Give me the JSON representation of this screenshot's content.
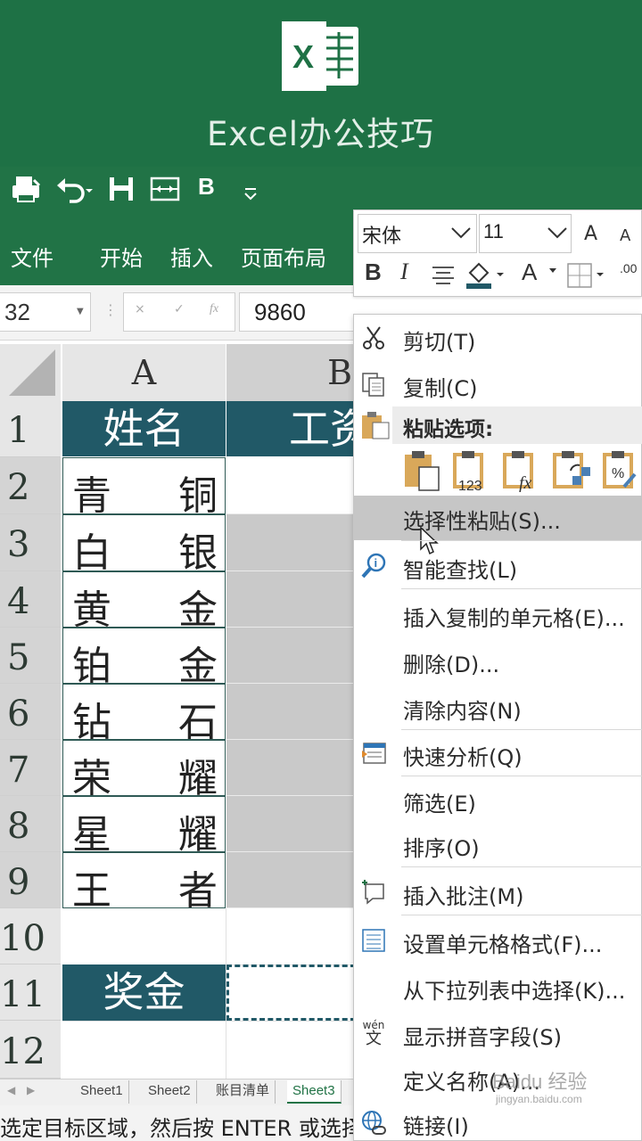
{
  "brand": {
    "logo_letter": "X",
    "title": "Excel办公技巧"
  },
  "qat": {
    "bold_label": "B"
  },
  "ribbon_tabs": [
    "文件",
    "开始",
    "插入",
    "页面布局"
  ],
  "formula_bar": {
    "name_box": "32",
    "value": "9860",
    "fx": "fx",
    "cancel": "×",
    "enter": "✓"
  },
  "columns": [
    "A",
    "B"
  ],
  "rows": [
    {
      "num": "1",
      "a": "姓名",
      "b": "工资",
      "header": true
    },
    {
      "num": "2",
      "a_left": "青",
      "a_right": "铜"
    },
    {
      "num": "3",
      "a_left": "白",
      "a_right": "银"
    },
    {
      "num": "4",
      "a_left": "黄",
      "a_right": "金"
    },
    {
      "num": "5",
      "a_left": "铂",
      "a_right": "金"
    },
    {
      "num": "6",
      "a_left": "钻",
      "a_right": "石"
    },
    {
      "num": "7",
      "a_left": "荣",
      "a_right": "耀"
    },
    {
      "num": "8",
      "a_left": "星",
      "a_right": "耀"
    },
    {
      "num": "9",
      "a_left": "王",
      "a_right": "者"
    },
    {
      "num": "10"
    },
    {
      "num": "11",
      "a": "奖金",
      "header": true
    },
    {
      "num": "12"
    }
  ],
  "sheet_tabs": [
    "Sheet1",
    "Sheet2",
    "账目清单",
    "Sheet3"
  ],
  "active_sheet": "Sheet3",
  "status_text": "选定目标区域，然后按 ENTER 或选择",
  "mini_toolbar": {
    "font_name": "宋体",
    "font_size": "11",
    "grow": "A",
    "shrink": "A",
    "bold": "B",
    "italic": "I",
    "font_color": "A",
    "decimal": ".00"
  },
  "context_menu": {
    "cut": "剪切(T)",
    "copy": "复制(C)",
    "paste_options": "粘贴选项:",
    "paste_123": "123",
    "paste_fx": "fx",
    "paste_pct": "%",
    "paste_special": "选择性粘贴(S)...",
    "smart_lookup": "智能查找(L)",
    "insert_copied": "插入复制的单元格(E)...",
    "delete": "删除(D)...",
    "clear": "清除内容(N)",
    "quick_analysis": "快速分析(Q)",
    "filter": "筛选(E)",
    "sort": "排序(O)",
    "insert_comment": "插入批注(M)",
    "format_cells": "设置单元格格式(F)...",
    "pick_list": "从下拉列表中选择(K)...",
    "phonetic": "显示拼音字段(S)",
    "phonetic_icon_top": "wén",
    "phonetic_icon_bottom": "文",
    "define_name": "定义名称(A)...",
    "link": "链接(I)"
  },
  "watermark": {
    "main": "Baidu 经验",
    "sub": "jingyan.baidu.com"
  },
  "colors": {
    "excel_green": "#217346",
    "header_teal": "#215967",
    "menu_hover": "#c6c6c6"
  }
}
